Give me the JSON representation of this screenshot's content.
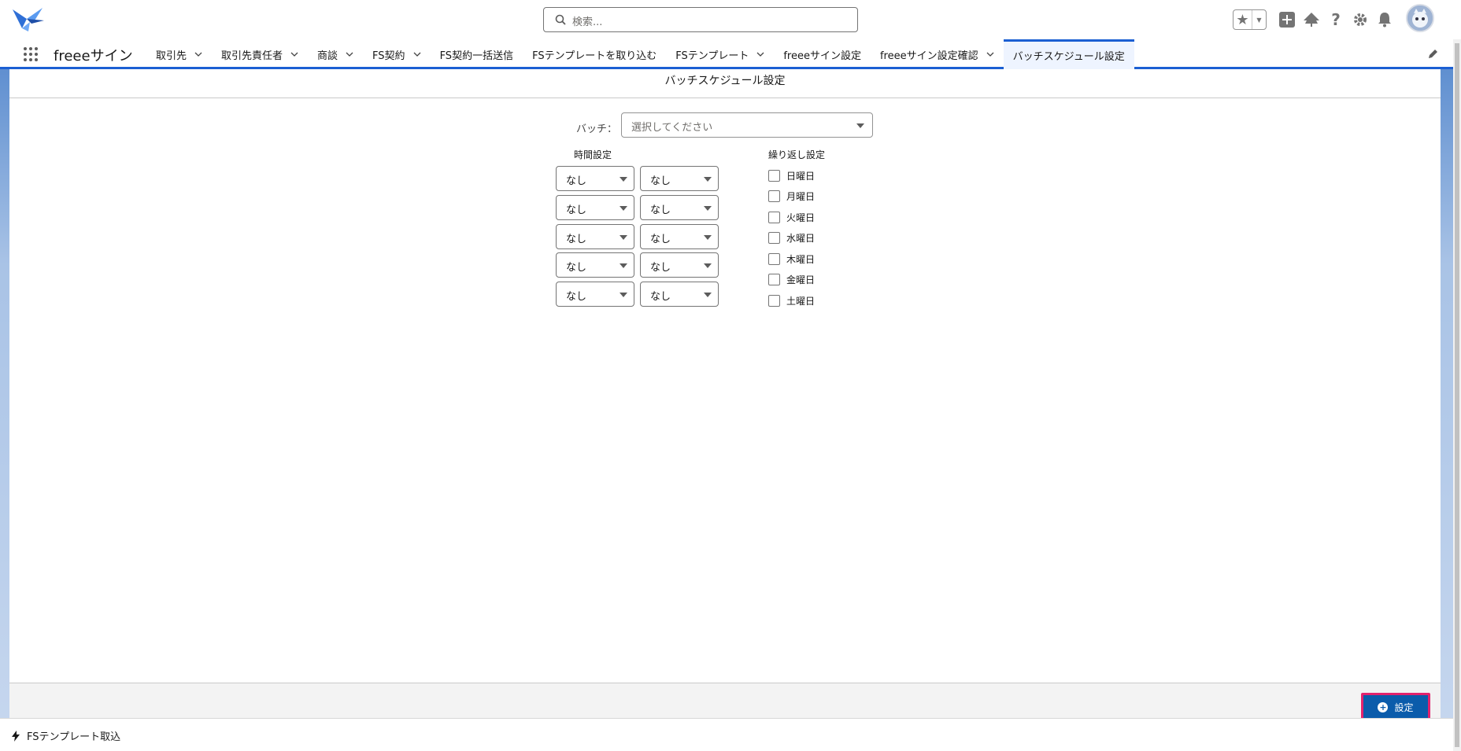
{
  "header": {
    "search_placeholder": "検索...",
    "icons": [
      "star-icon",
      "plus-icon",
      "trailhead-icon",
      "help-icon",
      "gear-icon",
      "bell-icon",
      "avatar"
    ]
  },
  "nav": {
    "app_name": "freeeサイン",
    "items": [
      {
        "label": "取引先",
        "chevron": true
      },
      {
        "label": "取引先責任者",
        "chevron": true
      },
      {
        "label": "商談",
        "chevron": true
      },
      {
        "label": "FS契約",
        "chevron": true
      },
      {
        "label": "FS契約一括送信",
        "chevron": false
      },
      {
        "label": "FSテンプレートを取り込む",
        "chevron": false
      },
      {
        "label": "FSテンプレート",
        "chevron": true
      },
      {
        "label": "freeeサイン設定",
        "chevron": false
      },
      {
        "label": "freeeサイン設定確認",
        "chevron": true
      },
      {
        "label": "バッチスケジュール設定",
        "chevron": false,
        "active": true
      }
    ]
  },
  "card": {
    "title": "バッチスケジュール設定",
    "batch_label": "バッチ：",
    "batch_placeholder": "選択してください",
    "time_label": "時間設定",
    "repeat_label": "繰り返し設定",
    "time_rows": [
      [
        "なし",
        "なし"
      ],
      [
        "なし",
        "なし"
      ],
      [
        "なし",
        "なし"
      ],
      [
        "なし",
        "なし"
      ],
      [
        "なし",
        "なし"
      ]
    ],
    "days": [
      "日曜日",
      "月曜日",
      "火曜日",
      "水曜日",
      "木曜日",
      "金曜日",
      "土曜日"
    ],
    "set_button": "設定"
  },
  "utility_bar": {
    "item": "FSテンプレート取込"
  },
  "colors": {
    "brand_blue": "#0b5cab",
    "nav_active": "#1b5fd3",
    "highlight": "#e3236d"
  }
}
